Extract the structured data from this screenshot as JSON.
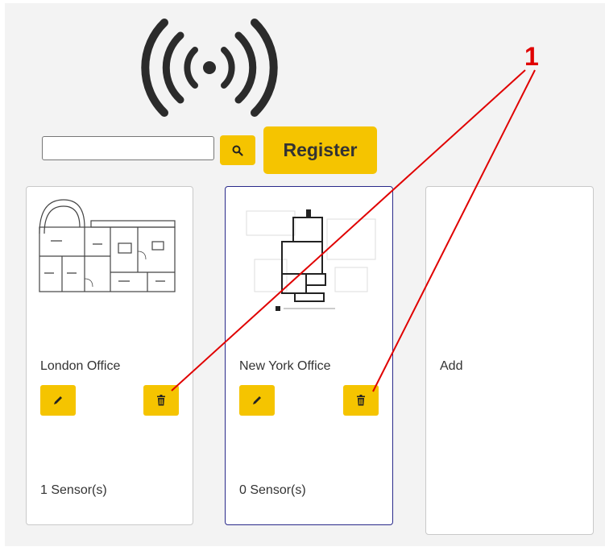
{
  "search": {
    "value": "",
    "placeholder": ""
  },
  "toolbar": {
    "register_label": "Register"
  },
  "cards": [
    {
      "title": "London Office",
      "sensors": "1 Sensor(s)"
    },
    {
      "title": "New York Office",
      "sensors": "0 Sensor(s)"
    }
  ],
  "add_card": {
    "label": "Add"
  },
  "annotation": {
    "number": "1"
  },
  "colors": {
    "accent": "#f5c400",
    "panel": "#f3f3f3",
    "annotation": "#e00000",
    "selected_border": "#2a2a8a"
  },
  "icons": [
    "wireless-signal-icon",
    "search-icon",
    "pencil-icon",
    "trash-icon"
  ]
}
